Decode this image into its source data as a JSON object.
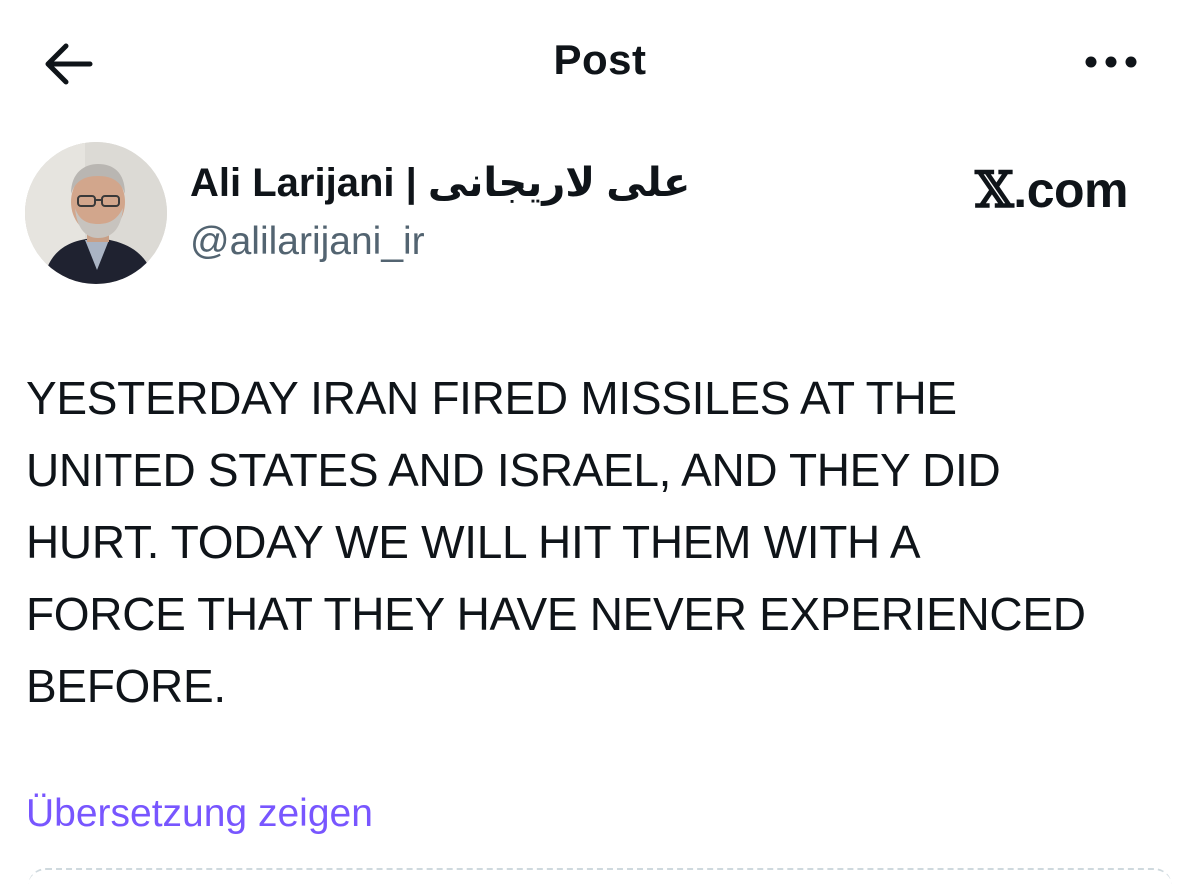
{
  "header": {
    "title": "Post",
    "back_icon": "arrow-left-icon",
    "more_icon": "more-horizontal-icon"
  },
  "author": {
    "name": "Ali Larijani | علی لاریجانی",
    "handle": "@alilarijani_ir",
    "avatar": "avatar-photo"
  },
  "brand": {
    "logo_x": "𝕏",
    "logo_suffix": ".com"
  },
  "post": {
    "text": "YESTERDAY IRAN FIRED MISSILES AT THE\nUNITED STATES AND ISRAEL, AND THEY DID\nHURT. TODAY WE WILL HIT THEM WITH A\nFORCE THAT THEY HAVE NEVER EXPERIENCED\nBEFORE."
  },
  "translate": {
    "label": "Übersetzung zeigen",
    "color": "#7856ff"
  },
  "colors": {
    "text": "#0f1419",
    "secondary": "#536471",
    "accent": "#7856ff"
  }
}
